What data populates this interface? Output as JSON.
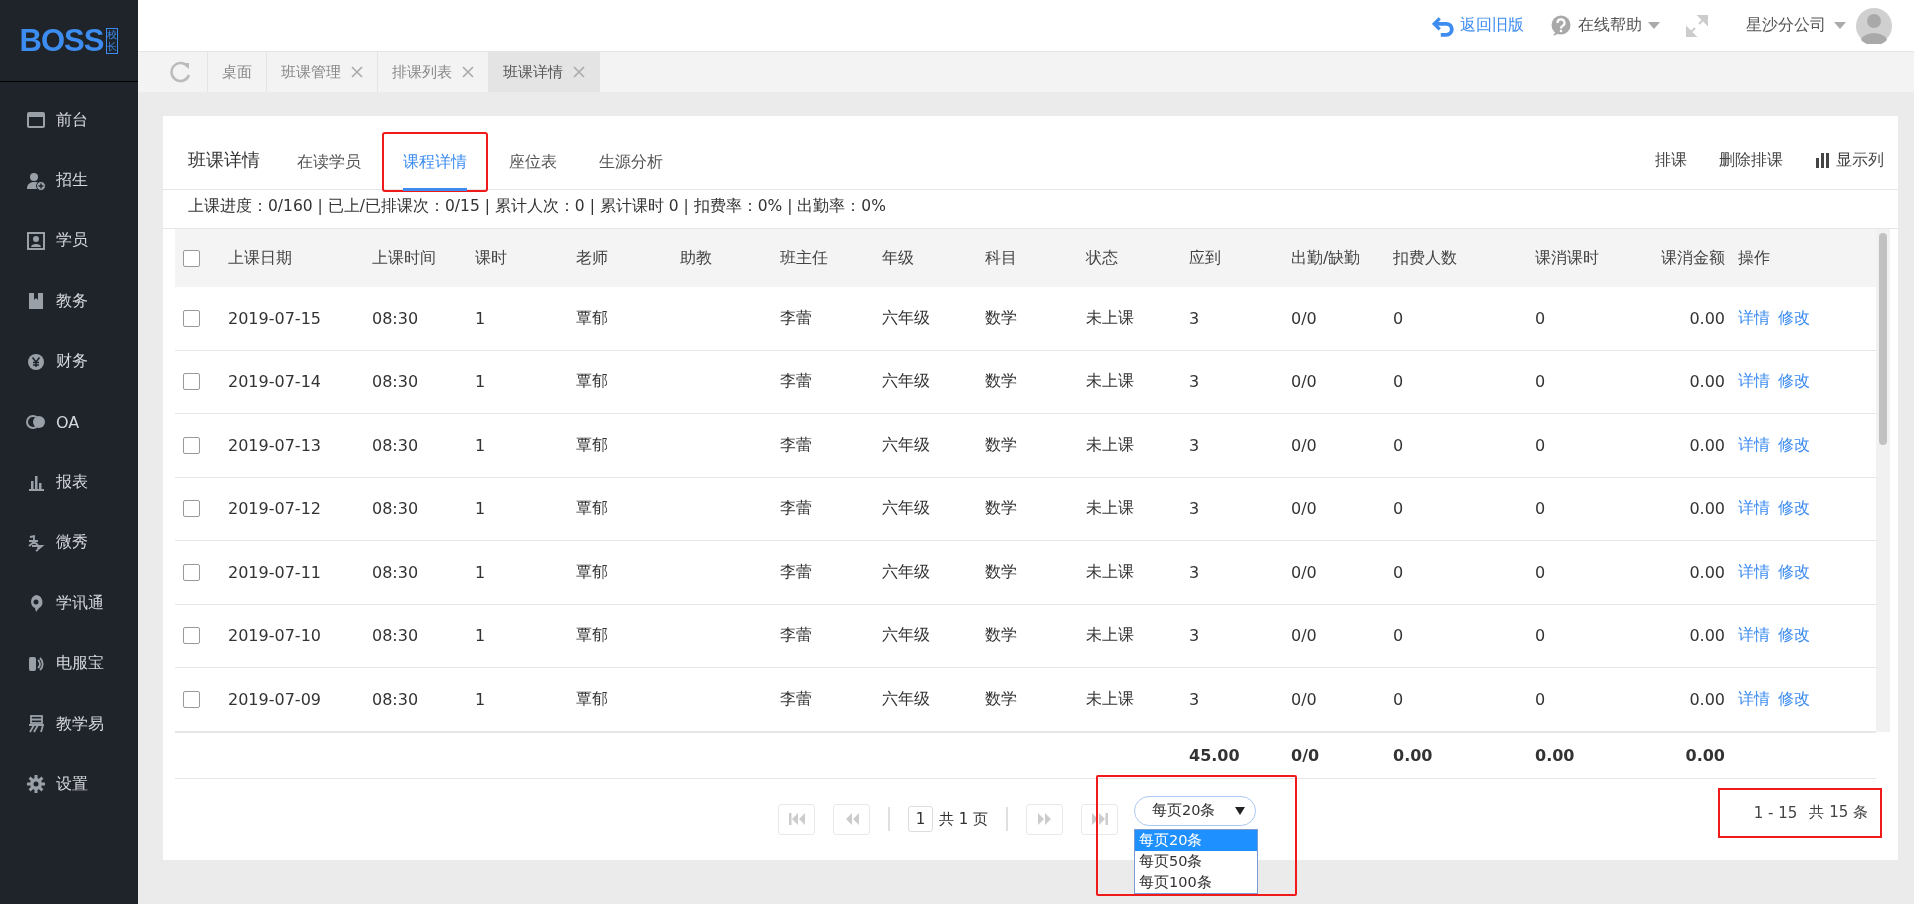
{
  "logo": {
    "text": "BOSS",
    "badge": "校长"
  },
  "sidebar": {
    "items": [
      {
        "label": "前台",
        "selected": false
      },
      {
        "label": "招生",
        "selected": false
      },
      {
        "label": "学员",
        "selected": false
      },
      {
        "label": "教务",
        "selected": false
      },
      {
        "label": "财务",
        "selected": false
      },
      {
        "label": "OA",
        "selected": false
      },
      {
        "label": "报表",
        "selected": false
      },
      {
        "label": "微秀",
        "selected": false
      },
      {
        "label": "学讯通",
        "selected": false
      },
      {
        "label": "电服宝",
        "selected": false
      },
      {
        "label": "教学易",
        "selected": false
      },
      {
        "label": "设置",
        "selected": false
      }
    ]
  },
  "top_bar": {
    "back_link": "返回旧版",
    "help": "在线帮助",
    "company": "星沙分公司"
  },
  "page_tabs": [
    {
      "label": "桌面",
      "closable": false,
      "selected": false
    },
    {
      "label": "班课管理",
      "closable": true,
      "selected": false
    },
    {
      "label": "排课列表",
      "closable": true,
      "selected": false
    },
    {
      "label": "班课详情",
      "closable": true,
      "selected": true
    }
  ],
  "card": {
    "title": "班课详情",
    "tabs": [
      {
        "label": "在读学员",
        "selected": false,
        "annotated": false
      },
      {
        "label": "课程详情",
        "selected": true,
        "annotated": true
      },
      {
        "label": "座位表",
        "selected": false,
        "annotated": false
      },
      {
        "label": "生源分析",
        "selected": false,
        "annotated": false
      }
    ],
    "actions": [
      "排课",
      "删除排课",
      "显示列"
    ],
    "summary": "上课进度：0/160 | 已上/已排课次：0/15 | 累计人次：0 | 累计课时 0 | 扣费率：0% | 出勤率：0%"
  },
  "table": {
    "all_checked": false,
    "columns": [
      "上课日期",
      "上课时间",
      "课时",
      "老师",
      "助教",
      "班主任",
      "年级",
      "科目",
      "状态",
      "应到",
      "出勤/缺勤",
      "扣费人数",
      "课消课时",
      "课消金额",
      "操作"
    ],
    "rows": [
      {
        "checked": false,
        "date": "2019-07-15",
        "time": "08:30",
        "hours": "1",
        "teacher": "覃郁",
        "head_teacher": "李蕾",
        "grade": "六年级",
        "subject": "数学",
        "status": "未上课",
        "expected": "3",
        "attendance": "0/0",
        "charged": "0",
        "consumed_hours": "0",
        "consumed_amount": "0.00",
        "actions": [
          "详情",
          "修改"
        ]
      },
      {
        "checked": false,
        "date": "2019-07-14",
        "time": "08:30",
        "hours": "1",
        "teacher": "覃郁",
        "head_teacher": "李蕾",
        "grade": "六年级",
        "subject": "数学",
        "status": "未上课",
        "expected": "3",
        "attendance": "0/0",
        "charged": "0",
        "consumed_hours": "0",
        "consumed_amount": "0.00",
        "actions": [
          "详情",
          "修改"
        ]
      },
      {
        "checked": false,
        "date": "2019-07-13",
        "time": "08:30",
        "hours": "1",
        "teacher": "覃郁",
        "head_teacher": "李蕾",
        "grade": "六年级",
        "subject": "数学",
        "status": "未上课",
        "expected": "3",
        "attendance": "0/0",
        "charged": "0",
        "consumed_hours": "0",
        "consumed_amount": "0.00",
        "actions": [
          "详情",
          "修改"
        ]
      },
      {
        "checked": false,
        "date": "2019-07-12",
        "time": "08:30",
        "hours": "1",
        "teacher": "覃郁",
        "head_teacher": "李蕾",
        "grade": "六年级",
        "subject": "数学",
        "status": "未上课",
        "expected": "3",
        "attendance": "0/0",
        "charged": "0",
        "consumed_hours": "0",
        "consumed_amount": "0.00",
        "actions": [
          "详情",
          "修改"
        ]
      },
      {
        "checked": false,
        "date": "2019-07-11",
        "time": "08:30",
        "hours": "1",
        "teacher": "覃郁",
        "head_teacher": "李蕾",
        "grade": "六年级",
        "subject": "数学",
        "status": "未上课",
        "expected": "3",
        "attendance": "0/0",
        "charged": "0",
        "consumed_hours": "0",
        "consumed_amount": "0.00",
        "actions": [
          "详情",
          "修改"
        ]
      },
      {
        "checked": false,
        "date": "2019-07-10",
        "time": "08:30",
        "hours": "1",
        "teacher": "覃郁",
        "head_teacher": "李蕾",
        "grade": "六年级",
        "subject": "数学",
        "status": "未上课",
        "expected": "3",
        "attendance": "0/0",
        "charged": "0",
        "consumed_hours": "0",
        "consumed_amount": "0.00",
        "actions": [
          "详情",
          "修改"
        ]
      },
      {
        "checked": false,
        "date": "2019-07-09",
        "time": "08:30",
        "hours": "1",
        "teacher": "覃郁",
        "head_teacher": "李蕾",
        "grade": "六年级",
        "subject": "数学",
        "status": "未上课",
        "expected": "3",
        "attendance": "0/0",
        "charged": "0",
        "consumed_hours": "0",
        "consumed_amount": "0.00",
        "actions": [
          "详情",
          "修改"
        ]
      }
    ],
    "totals": {
      "expected": "45.00",
      "attendance": "0/0",
      "charged": "0.00",
      "consumed_hours": "0.00",
      "consumed_amount": "0.00"
    }
  },
  "pagination": {
    "page": "1",
    "page_text": "共 1 页",
    "page_size": "每页20条",
    "size_annotated": true,
    "options": [
      {
        "label": "每页20条",
        "selected": true
      },
      {
        "label": "每页50条",
        "selected": false
      },
      {
        "label": "每页100条",
        "selected": false
      }
    ],
    "range": "1 - 15",
    "total": "共 15 条",
    "count_annotated": true
  }
}
